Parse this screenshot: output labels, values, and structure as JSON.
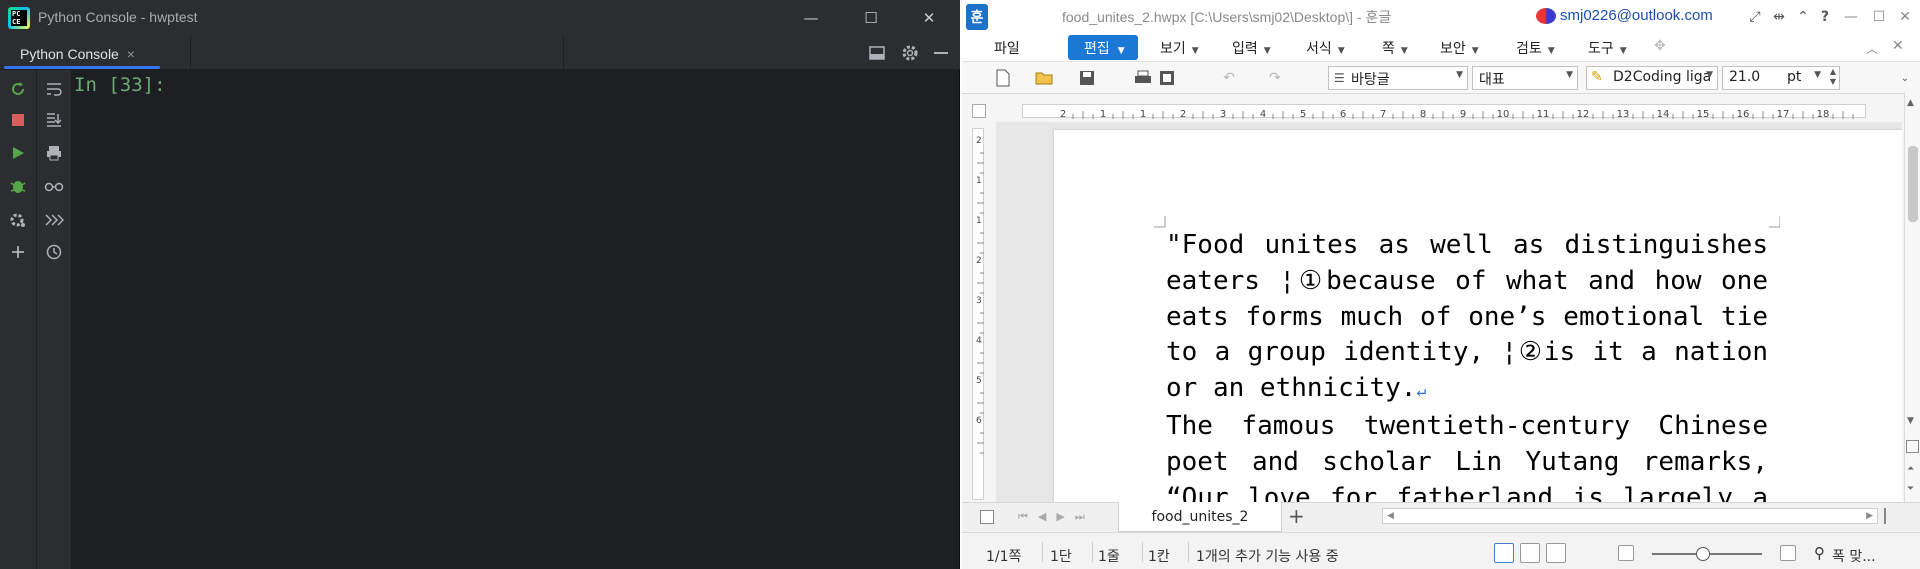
{
  "pycharm": {
    "title": "Python Console - hwptest",
    "tab_label": "Python Console",
    "tab_close": "×",
    "prompt": "In [33]:",
    "win_minimize": "—",
    "win_maximize": "☐",
    "win_close": "✕",
    "accent": "#3574f0",
    "prompt_color": "#6aab73"
  },
  "hangul": {
    "app_logo": "훈",
    "title": "food_unites_2.hwpx [C:\\Users\\smj02\\Desktop\\] - 훈글",
    "user": "smj0226@outlook.com",
    "menus": [
      "파일",
      "편집",
      "보기",
      "입력",
      "서식",
      "쪽",
      "보안",
      "검토",
      "도구"
    ],
    "active_menu": "편집",
    "style_combo": "바탕글",
    "font_lang_combo": "대표",
    "font_combo": "D2Coding liga",
    "size_combo": "21.0",
    "size_unit": "pt",
    "ruler_numbers": [
      "2",
      "1",
      "1",
      "2",
      "3",
      "4",
      "5",
      "6",
      "7",
      "8",
      "9",
      "10",
      "11",
      "12",
      "13",
      "14",
      "15",
      "16",
      "17",
      "18"
    ],
    "vruler_numbers": [
      "2",
      "1",
      "1",
      "2",
      "3",
      "4",
      "5",
      "6"
    ],
    "body_lines": [
      "\"Food unites as well as distinguishes",
      "eaters ¦①because of what and how one",
      "eats forms much of one’s emotional tie",
      "to a group identity, ¦②is it a nation",
      "or an ethnicity.",
      " The famous twentieth-century Chinese",
      "poet and scholar Lin Yutang remarks,",
      "“Our love for fatherland is largely a"
    ],
    "para_mark": "↵",
    "sheet_tab": "food_unites_2",
    "add_sheet": "+",
    "status": {
      "page": "1/1쪽",
      "section": "1단",
      "line": "1줄",
      "column": "1칸",
      "message": "1개의 추가 기능 사용 중",
      "zoom_label": "폭 맞..."
    },
    "accent": "#1b78d4",
    "user_color": "#1a4fb3"
  }
}
